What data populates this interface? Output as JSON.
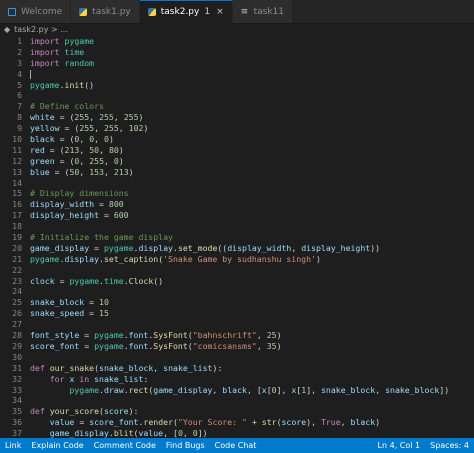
{
  "tabs": [
    {
      "label": "Welcome",
      "icon": "vscode-icon",
      "active": false
    },
    {
      "label": "task1.py",
      "icon": "python-icon",
      "active": false
    },
    {
      "label": "task2.py",
      "icon": "python-icon",
      "active": true,
      "marker": "1"
    },
    {
      "label": "task11",
      "icon": "file-icon",
      "active": false
    }
  ],
  "breadcrumb": "task2.py > ...",
  "code_lines": [
    {
      "n": "1",
      "text": "import pygame"
    },
    {
      "n": "2",
      "text": "import time"
    },
    {
      "n": "3",
      "text": "import random"
    },
    {
      "n": "4",
      "text": ""
    },
    {
      "n": "5",
      "text": "pygame.init()"
    },
    {
      "n": "6",
      "text": ""
    },
    {
      "n": "7",
      "text": "# Define colors"
    },
    {
      "n": "8",
      "text": "white = (255, 255, 255)"
    },
    {
      "n": "9",
      "text": "yellow = (255, 255, 102)"
    },
    {
      "n": "10",
      "text": "black = (0, 0, 0)"
    },
    {
      "n": "11",
      "text": "red = (213, 50, 80)"
    },
    {
      "n": "12",
      "text": "green = (0, 255, 0)"
    },
    {
      "n": "13",
      "text": "blue = (50, 153, 213)"
    },
    {
      "n": "14",
      "text": ""
    },
    {
      "n": "15",
      "text": "# Display dimensions"
    },
    {
      "n": "16",
      "text": "display_width = 800"
    },
    {
      "n": "17",
      "text": "display_height = 600"
    },
    {
      "n": "18",
      "text": ""
    },
    {
      "n": "19",
      "text": "# Initialize the game display"
    },
    {
      "n": "20",
      "text": "game_display = pygame.display.set_mode((display_width, display_height))"
    },
    {
      "n": "21",
      "text": "pygame.display.set_caption('Snake Game by sudhanshu singh')"
    },
    {
      "n": "22",
      "text": ""
    },
    {
      "n": "23",
      "text": "clock = pygame.time.Clock()"
    },
    {
      "n": "24",
      "text": ""
    },
    {
      "n": "25",
      "text": "snake_block = 10"
    },
    {
      "n": "26",
      "text": "snake_speed = 15"
    },
    {
      "n": "27",
      "text": ""
    },
    {
      "n": "28",
      "text": "font_style = pygame.font.SysFont(\"bahnschrift\", 25)"
    },
    {
      "n": "29",
      "text": "score_font = pygame.font.SysFont(\"comicsansms\", 35)"
    },
    {
      "n": "30",
      "text": ""
    },
    {
      "n": "31",
      "text": "def our_snake(snake_block, snake_list):"
    },
    {
      "n": "32",
      "text": "    for x in snake_list:"
    },
    {
      "n": "33",
      "text": "        pygame.draw.rect(game_display, black, [x[0], x[1], snake_block, snake_block])"
    },
    {
      "n": "34",
      "text": ""
    },
    {
      "n": "35",
      "text": "def your_score(score):"
    },
    {
      "n": "36",
      "text": "    value = score_font.render(\"Your Score: \" + str(score), True, black)"
    },
    {
      "n": "37",
      "text": "    game_display.blit(value, [0, 0])"
    }
  ],
  "status_left": [
    "Link",
    "Explain Code",
    "Comment Code",
    "Find Bugs",
    "Code Chat"
  ],
  "status_right": [
    "Ln 4, Col 1",
    "Spaces: 4"
  ],
  "colors": {
    "keyword": "#c586c0",
    "module": "#4ec9b0",
    "function": "#dcdcaa",
    "string": "#ce9178",
    "number": "#b5cea8",
    "comment": "#6a9955",
    "variable": "#9cdcfe",
    "statusbar": "#007acc"
  }
}
